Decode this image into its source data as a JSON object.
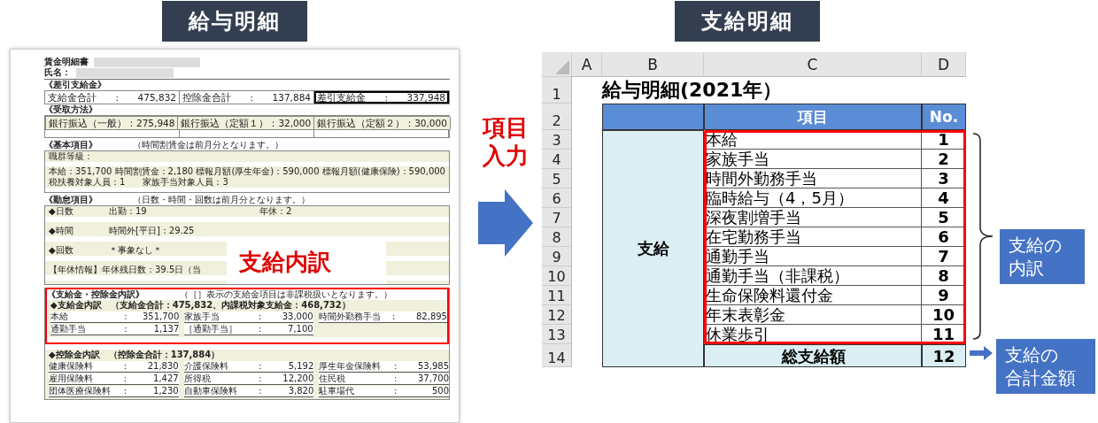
{
  "left_title": "給与明細",
  "right_title": "支給明細",
  "payslip": {
    "title": "賃金明細書",
    "name_label": "氏名：",
    "summary": {
      "heading": "《差引支給金》",
      "separator": ":",
      "cells": [
        {
          "label": "支給金合計",
          "value": "475,832",
          "emphasized": false
        },
        {
          "label": "控除金合計",
          "value": "137,884",
          "emphasized": false
        },
        {
          "label": "差引支給金",
          "value": "337,948",
          "emphasized": true
        }
      ]
    },
    "payment": {
      "heading": "《受取方法》",
      "separator": "：",
      "cells": [
        {
          "label": "銀行振込（一般）",
          "value": "275,948",
          "emphasized": false
        },
        {
          "label": "銀行振込（定額１）",
          "value": "32,000",
          "emphasized": false
        },
        {
          "label": "銀行振込（定額２）",
          "value": "30,000",
          "emphasized": false
        }
      ]
    },
    "basic": {
      "heading": "《基本項目》",
      "note": "（時間割賃金は前月分となります。）",
      "rows": [
        [
          "職群等級："
        ],
        [
          "本給：351,700",
          "時間割賃金：2,180",
          "標報月額(厚生年金)：590,000",
          "標報月額(健康保険)：590,000"
        ],
        [
          "税扶養対象人員：1",
          "家族手当対象人員：3"
        ]
      ]
    },
    "attendance": {
      "heading": "《勤怠項目》",
      "note": "（日数・時間・回数は前月分となります。）",
      "rows": [
        [
          "◆日数",
          "出勤：19",
          "年休：2"
        ],
        [
          "◆時間",
          "時間外[平日]：29.25"
        ],
        [
          "◆回数",
          "＊事象なし＊"
        ],
        [
          "【年休情報】年休残日数：39.5日（当"
        ]
      ]
    },
    "overlay_label": "支給内訳",
    "breakdown": {
      "heading": "《支給金・控除金内訳》",
      "note": "（［］表示の支給金項目は非課税扱いとなります。）",
      "highlighted": true,
      "separator": ":",
      "groups": [
        {
          "heading": "◆支給金内訳　（支給金合計：475,832、内課税対象支給金：468,732）",
          "items": [
            {
              "label": "本給",
              "value": "351,700"
            },
            {
              "label": "家族手当",
              "value": "33,000"
            },
            {
              "label": "時間外勤務手当",
              "value": "82,895"
            },
            {
              "label": "通勤手当",
              "value": "1,137"
            },
            {
              "label": "［通勤手当］",
              "value": "7,100"
            }
          ]
        },
        {
          "heading": "◆控除金内訳　（控除金合計：137,884）",
          "items": [
            {
              "label": "健康保険料",
              "value": "21,830"
            },
            {
              "label": "介護保険料",
              "value": "5,192"
            },
            {
              "label": "厚生年金保険料",
              "value": "53,985"
            },
            {
              "label": "雇用保険料",
              "value": "1,427"
            },
            {
              "label": "所得税",
              "value": "12,200"
            },
            {
              "label": "住民税",
              "value": "37,700"
            },
            {
              "label": "団体医療保険料",
              "value": "1,230"
            },
            {
              "label": "自動車保険料",
              "value": "3,820"
            },
            {
              "label": "駐車場代",
              "value": "500"
            }
          ]
        }
      ]
    }
  },
  "middle_label": [
    "項目",
    "入力"
  ],
  "spreadsheet": {
    "columns": [
      "A",
      "B",
      "C",
      "D"
    ],
    "row_numbers": [
      "1",
      "2",
      "3",
      "4",
      "5",
      "6",
      "7",
      "8",
      "9",
      "10",
      "11",
      "12",
      "13",
      "14"
    ],
    "title": "給与明細(2021年）",
    "header_item": "項目",
    "header_no": "No.",
    "group_label": "支給",
    "highlighted": true,
    "items": [
      {
        "name": "本給",
        "no": "1"
      },
      {
        "name": "家族手当",
        "no": "2"
      },
      {
        "name": "時間外勤務手当",
        "no": "3"
      },
      {
        "name": "臨時給与（4，5月）",
        "no": "4"
      },
      {
        "name": "深夜割増手当",
        "no": "5"
      },
      {
        "name": "在宅勤務手当",
        "no": "6"
      },
      {
        "name": "通勤手当",
        "no": "7"
      },
      {
        "name": "通勤手当（非課税）",
        "no": "8"
      },
      {
        "name": "生命保険料還付金",
        "no": "9"
      },
      {
        "name": "年末表彰金",
        "no": "10"
      },
      {
        "name": "休業歩引",
        "no": "11"
      }
    ],
    "total": {
      "name": "総支給額",
      "no": "12"
    }
  },
  "callouts": [
    [
      "支給の",
      "内訳"
    ],
    [
      "支給の",
      "合計金額"
    ]
  ]
}
